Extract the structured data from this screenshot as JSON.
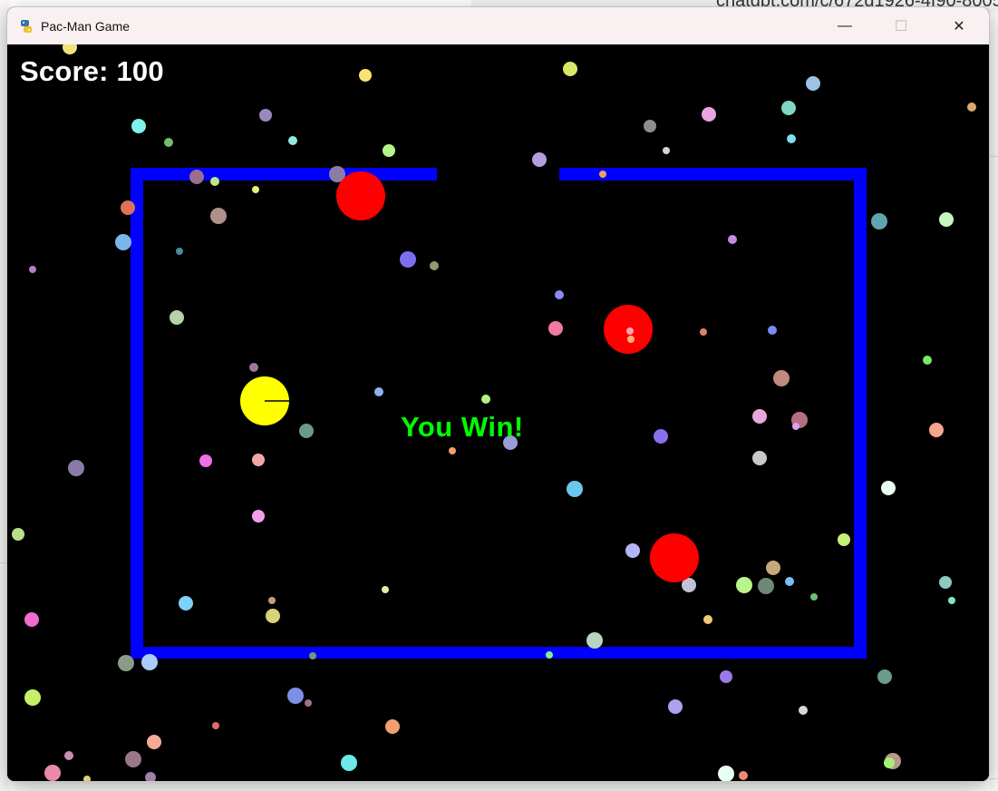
{
  "window": {
    "title": "Pac-Man Game",
    "minimize_glyph": "—",
    "maximize_glyph": "☐",
    "close_glyph": "✕"
  },
  "hud": {
    "score_text": "Score: 100",
    "win_text": "You Win!"
  },
  "background": {
    "url_text": "chatgpt.com/c/672d1926-4f90-8005-"
  },
  "colors": {
    "maze_wall": "#0000ff",
    "pacman": "#ffff00",
    "ghost": "#ff0000",
    "win_text": "#00ff00",
    "score_text": "#ffffff",
    "playfield": "#000000"
  },
  "entities": {
    "pacman": {
      "icon": "pacman-icon"
    },
    "ghosts": [
      {
        "icon": "ghost-icon"
      },
      {
        "icon": "ghost-icon"
      },
      {
        "icon": "ghost-icon"
      }
    ]
  }
}
